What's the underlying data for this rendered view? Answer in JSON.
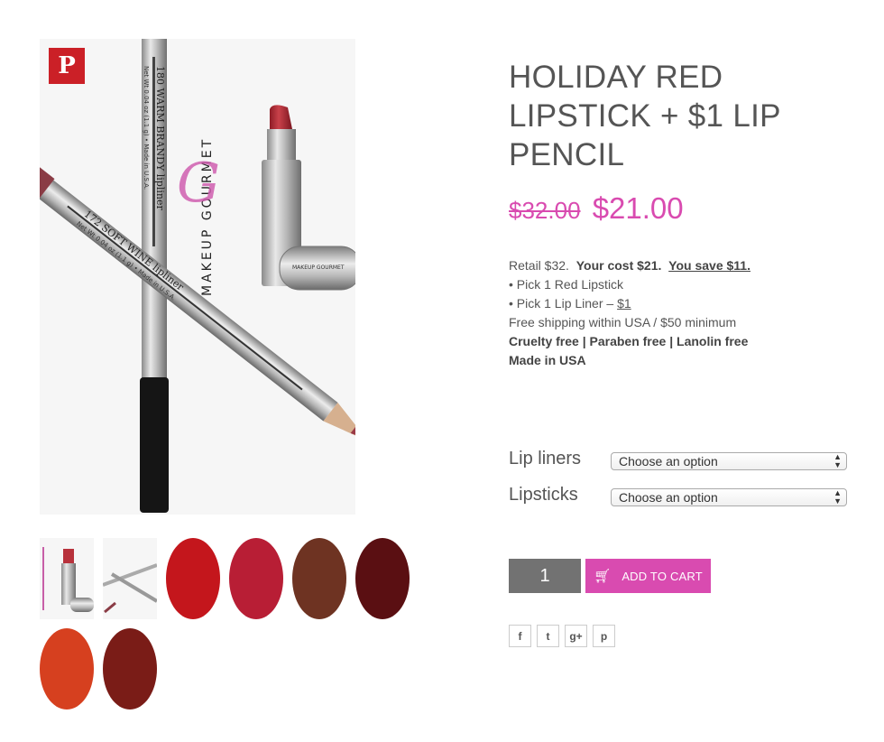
{
  "product": {
    "title": "HOLIDAY RED LIPSTICK + $1 LIP PENCIL",
    "price_old": "$32.00",
    "price_new": "$21.00"
  },
  "description": {
    "line1_a": "Retail $32.",
    "line1_b": "Your cost $21.",
    "line1_c": "You save $11.",
    "line2": "• Pick 1 Red Lipstick",
    "line3_a": "• Pick 1 Lip Liner – ",
    "line3_b": "$1",
    "line4": "Free shipping within USA / $50 minimum",
    "line5": "Cruelty free | Paraben free | Lanolin free",
    "line6": "Made in USA"
  },
  "image": {
    "pencil1_text": "180 WARM BRANDY lipliner",
    "pencil1_sub": "Net Wt 0.04 oz (1.1 g) • Made in U.S.A.",
    "pencil2_text": "172 SOFT WINE lipliner",
    "pencil2_sub": "Net Wt 0.04 oz (1.1 g) • Made in U.S.A.",
    "brand": "MAKEUP GOURMET",
    "cap_brand": "MAKEUP GOURMET"
  },
  "variations": {
    "liners_label": "Lip liners",
    "liners_value": "Choose an option",
    "lipsticks_label": "Lipsticks",
    "lipsticks_value": "Choose an option"
  },
  "cart": {
    "quantity": "1",
    "add_label": "Add to cart"
  },
  "share": {
    "facebook": "f",
    "twitter": "t",
    "google": "g+",
    "pinterest": "p"
  },
  "pin_glyph": "P",
  "swatch_colors": [
    "#c4161c",
    "#b81e35",
    "#6e3322",
    "#5a0f12",
    "#d6401f",
    "#7a1c17"
  ],
  "accent_color": "#d94bb0"
}
